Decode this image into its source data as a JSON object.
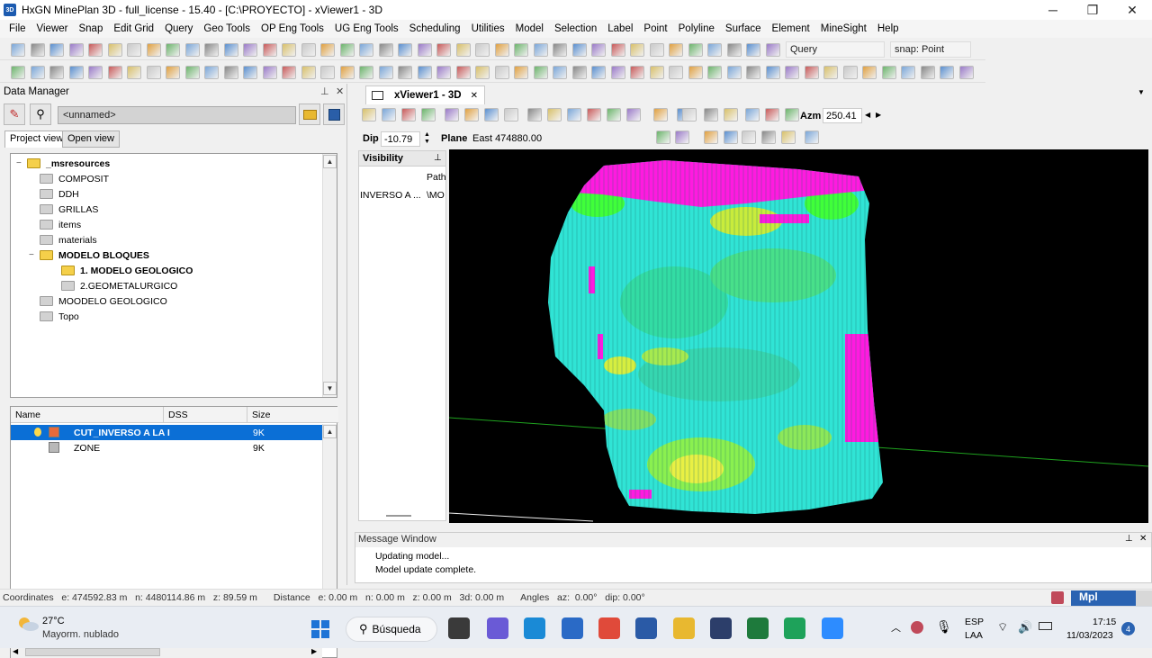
{
  "window": {
    "app_icon_text": "3D",
    "title": "HxGN MinePlan 3D - full_license - 15.40 - [C:\\PROYECTO] - xViewer1 - 3D",
    "controls": {
      "minimize": "─",
      "maximize": "❐",
      "close": "✕"
    }
  },
  "menu": [
    "File",
    "Viewer",
    "Snap",
    "Edit Grid",
    "Query",
    "Geo Tools",
    "OP Eng Tools",
    "UG Eng Tools",
    "Scheduling",
    "Utilities",
    "Model",
    "Selection",
    "Label",
    "Point",
    "Polyline",
    "Surface",
    "Element",
    "MineSight",
    "Help"
  ],
  "toolbar": {
    "query_label": "Query",
    "snap_label": "snap: Point"
  },
  "data_manager": {
    "title": "Data Manager",
    "pin": "📌",
    "close": "✕",
    "path_value": "<unnamed>",
    "tabs": [
      "Project view",
      "Open view"
    ],
    "tree": [
      {
        "label": "_msresources",
        "bold": true,
        "level": 0,
        "expander": "−"
      },
      {
        "label": "COMPOSIT",
        "bold": false,
        "level": 1
      },
      {
        "label": "DDH",
        "bold": false,
        "level": 1
      },
      {
        "label": "GRILLAS",
        "bold": false,
        "level": 1
      },
      {
        "label": "items",
        "bold": false,
        "level": 1
      },
      {
        "label": "materials",
        "bold": false,
        "level": 1
      },
      {
        "label": "MODELO BLOQUES",
        "bold": true,
        "level": 1,
        "expander": "−"
      },
      {
        "label": "1. MODELO GEOLOGICO",
        "bold": true,
        "level": 2
      },
      {
        "label": "2.GEOMETALURGICO",
        "bold": false,
        "level": 2
      },
      {
        "label": "MOODELO GEOLOGICO",
        "bold": false,
        "level": 1
      },
      {
        "label": "Topo",
        "bold": false,
        "level": 1
      }
    ],
    "list_headers": [
      "Name",
      "DSS",
      "Size"
    ],
    "list_rows": [
      {
        "name": "CUT_INVERSO A LA I",
        "dss": "",
        "size": "9K",
        "selected": true
      },
      {
        "name": "ZONE",
        "dss": "",
        "size": "9K",
        "selected": false
      }
    ]
  },
  "viewer": {
    "tab_label": "xViewer1 - 3D",
    "tab_close": "✕",
    "azm_label": "Azm",
    "azm_value": "250.41",
    "dip_label": "Dip",
    "dip_value": "-10.79",
    "plane_label": "Plane",
    "plane_value": "East 474880.00",
    "visibility_title": "Visibility",
    "visibility_col": "Path",
    "visibility_row_name": "INVERSO A ...",
    "visibility_row_path": "\\MO",
    "colors": {
      "magenta": "#ff00ff",
      "cyan": "#2ee6d6",
      "green": "#40ff3a",
      "yellow": "#e8f044"
    }
  },
  "message_window": {
    "title": "Message Window",
    "messages": [
      "Updating model...",
      "Model update complete."
    ]
  },
  "status": {
    "coordinates": "Coordinates   e: 474592.83 m   n: 4480114.86 m   z: 89.59 m",
    "distance": "Distance   e: 0.00 m   n: 0.00 m   z: 0.00 m   3d: 0.00 m",
    "angles": "Angles   az:  0.00°   dip: 0.00°",
    "mpl": "Mpl"
  },
  "taskbar": {
    "weather_temp": "27°C",
    "weather_desc": "Mayorm. nublado",
    "search_label": "Búsqueda",
    "lang_top": "ESP",
    "lang_bottom": "LAA",
    "time": "17:15",
    "date": "11/03/2023",
    "notification_count": "4"
  }
}
